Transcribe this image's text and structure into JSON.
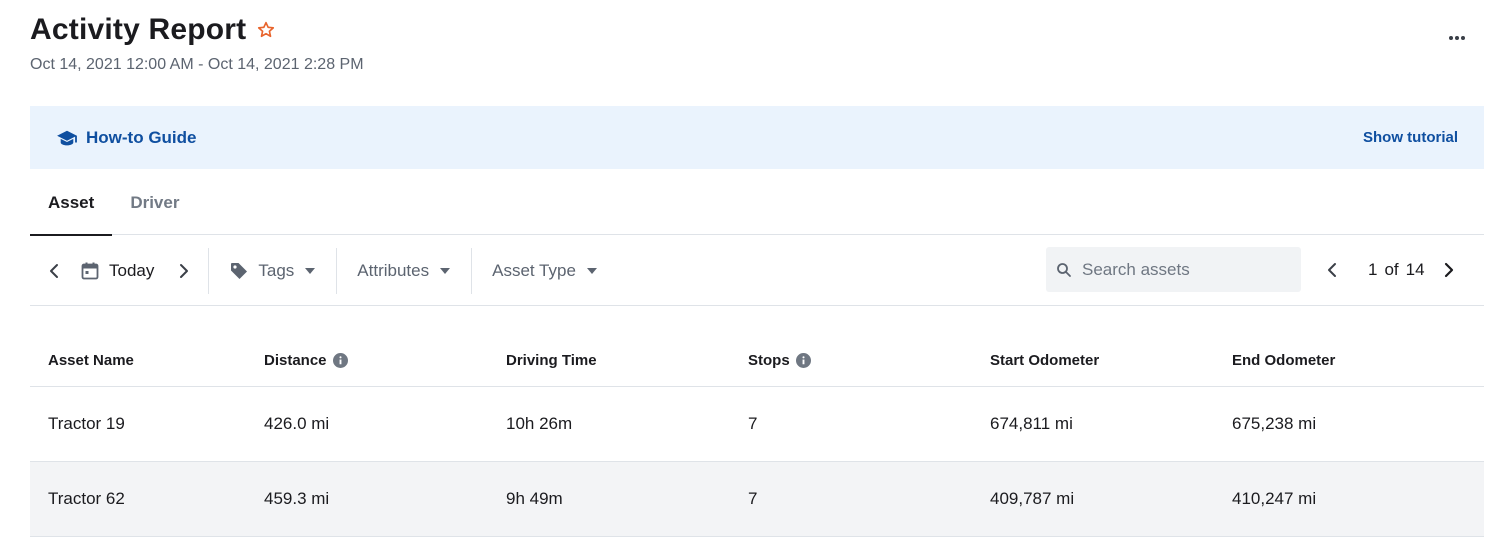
{
  "header": {
    "title": "Activity Report",
    "date_range": "Oct 14, 2021 12:00 AM - Oct 14, 2021 2:28 PM"
  },
  "guide": {
    "label": "How-to Guide",
    "action": "Show tutorial"
  },
  "tabs": [
    {
      "label": "Asset",
      "active": true
    },
    {
      "label": "Driver",
      "active": false
    }
  ],
  "toolbar": {
    "date_label": "Today",
    "filters": [
      "Tags",
      "Attributes",
      "Asset Type"
    ],
    "search_placeholder": "Search assets",
    "pager": {
      "current": "1",
      "of": "of",
      "total": "14"
    }
  },
  "table": {
    "columns": [
      "Asset Name",
      "Distance",
      "Driving Time",
      "Stops",
      "Start Odometer",
      "End Odometer"
    ],
    "rows": [
      [
        "Tractor 19",
        "426.0 mi",
        "10h 26m",
        "7",
        "674,811 mi",
        "675,238 mi"
      ],
      [
        "Tractor 62",
        "459.3 mi",
        "9h 49m",
        "7",
        "409,787 mi",
        "410,247 mi"
      ]
    ]
  },
  "colors": {
    "accent": "#0f4fa0",
    "star": "#e8642c",
    "guide_bg": "#eaf3fd"
  },
  "icons": [
    "star-outline-icon",
    "more-horizontal-icon",
    "graduation-cap-icon",
    "chevron-left-icon",
    "calendar-icon",
    "chevron-right-icon",
    "tag-icon",
    "caret-down-icon",
    "search-icon",
    "info-icon"
  ]
}
